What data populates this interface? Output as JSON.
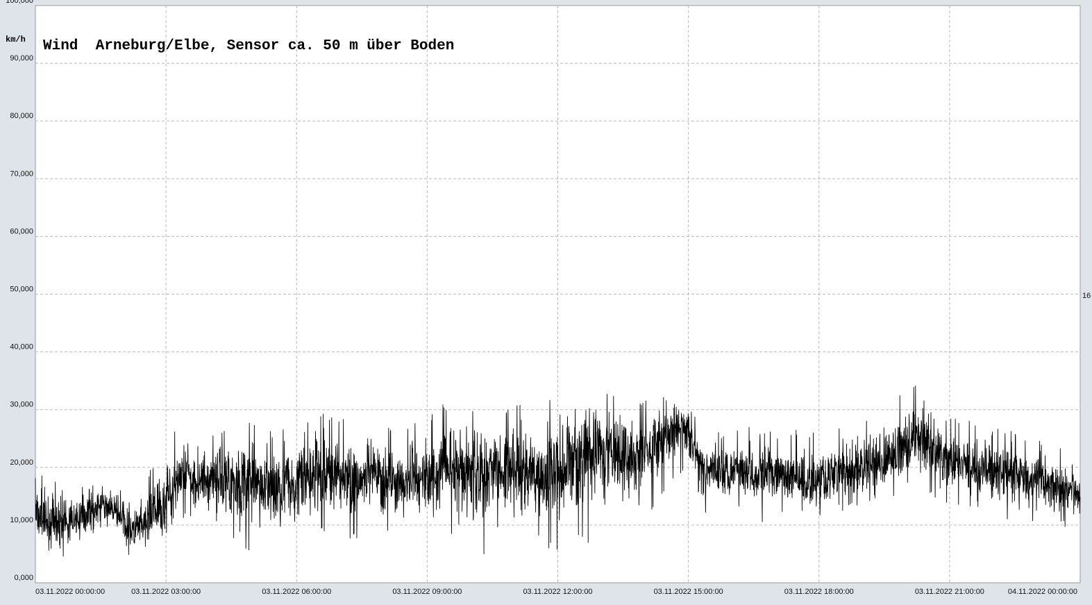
{
  "chart_data": {
    "type": "line",
    "title": "Wind  Arneburg/Elbe, Sensor ca. 50 m über Boden",
    "ylabel": "km/h",
    "xlabel": "",
    "ylim": [
      0,
      100000
    ],
    "xlim_hours": [
      0,
      24
    ],
    "grid": true,
    "line_color": "#000000",
    "grid_color": "#b8b8b8",
    "yticks": [
      "0,000",
      "10,000",
      "20,000",
      "30,000",
      "40,000",
      "50,000",
      "60,000",
      "70,000",
      "80,000",
      "90,000",
      "100,000"
    ],
    "ytick_values": [
      0,
      10000,
      20000,
      30000,
      40000,
      50000,
      60000,
      70000,
      80000,
      90000,
      100000
    ],
    "xticks": [
      "03.11.2022  00:00:00",
      "03.11.2022  03:00:00",
      "03.11.2022  06:00:00",
      "03.11.2022  09:00:00",
      "03.11.2022  12:00:00",
      "03.11.2022  15:00:00",
      "03.11.2022  18:00:00",
      "03.11.2022  21:00:00",
      "04.11.2022  00:00:00"
    ],
    "xtick_hours": [
      0,
      3,
      6,
      9,
      12,
      15,
      18,
      21,
      24
    ],
    "right_edge_label": "16",
    "series": [
      {
        "x_hours": [
          0,
          0.25,
          0.5,
          0.75,
          1,
          1.25,
          1.5,
          1.75,
          2,
          2.25,
          2.5,
          2.75,
          3,
          3.25,
          3.5,
          3.75,
          4,
          4.25,
          4.5,
          4.75,
          5,
          5.25,
          5.5,
          5.75,
          6,
          6.25,
          6.5,
          6.75,
          7,
          7.25,
          7.5,
          7.75,
          8,
          8.25,
          8.5,
          8.75,
          9,
          9.25,
          9.5,
          9.75,
          10,
          10.25,
          10.5,
          10.75,
          11,
          11.25,
          11.5,
          11.75,
          12,
          12.25,
          12.5,
          12.75,
          13,
          13.25,
          13.5,
          13.75,
          14,
          14.25,
          14.5,
          14.75,
          15,
          15.25,
          15.5,
          15.75,
          16,
          16.25,
          16.5,
          16.75,
          17,
          17.25,
          17.5,
          17.75,
          18,
          18.25,
          18.5,
          18.75,
          19,
          19.25,
          19.5,
          19.75,
          20,
          20.25,
          20.5,
          20.75,
          21,
          21.25,
          21.5,
          21.75,
          22,
          22.25,
          22.5,
          22.75,
          23,
          23.25,
          23.5,
          23.75,
          24
        ],
        "mean": [
          11000,
          10500,
          10000,
          10500,
          11000,
          12500,
          13500,
          13000,
          11000,
          9000,
          9500,
          11500,
          14000,
          17500,
          18500,
          17500,
          18000,
          18500,
          18000,
          17500,
          17000,
          16500,
          16000,
          17000,
          17500,
          18000,
          18500,
          19000,
          18500,
          18000,
          17500,
          18500,
          18000,
          17500,
          17500,
          18000,
          18500,
          19000,
          19500,
          20000,
          19500,
          19000,
          19500,
          19000,
          18500,
          19000,
          19000,
          19500,
          20000,
          21000,
          22000,
          22500,
          23000,
          22500,
          22000,
          21500,
          22000,
          23500,
          26000,
          27000,
          26500,
          20500,
          19500,
          19500,
          20000,
          20000,
          19500,
          19000,
          18500,
          18000,
          17500,
          17000,
          18000,
          18500,
          19000,
          19500,
          20000,
          20500,
          21000,
          22000,
          24000,
          25000,
          24500,
          22000,
          21000,
          20500,
          20000,
          20000,
          19500,
          19000,
          18500,
          18000,
          17500,
          17000,
          16500,
          16000,
          15500
        ],
        "max": [
          19500,
          18500,
          17500,
          17000,
          17000,
          17000,
          17500,
          17500,
          16000,
          15000,
          17500,
          21500,
          25000,
          27500,
          25500,
          25000,
          26500,
          27000,
          28500,
          28500,
          28000,
          27000,
          26500,
          28000,
          28500,
          29000,
          30500,
          29000,
          28500,
          28000,
          28000,
          28500,
          27500,
          26500,
          26500,
          28500,
          29000,
          30500,
          31500,
          31000,
          30500,
          34000,
          31000,
          30500,
          31000,
          32000,
          31500,
          31500,
          33000,
          35500,
          34000,
          35000,
          34500,
          33500,
          33000,
          31000,
          31500,
          32500,
          33000,
          33000,
          32000,
          27000,
          26500,
          26000,
          27000,
          27500,
          27000,
          26500,
          26500,
          26000,
          26500,
          26000,
          26500,
          27000,
          28000,
          28500,
          29000,
          29000,
          29500,
          31500,
          35500,
          35000,
          34000,
          30000,
          29000,
          28500,
          28000,
          27500,
          27000,
          26500,
          26500,
          26000,
          25500,
          24500,
          23500,
          22500,
          21000
        ],
        "min": [
          5000,
          4000,
          3500,
          5000,
          6000,
          7500,
          9000,
          9000,
          7000,
          3000,
          5000,
          6000,
          8000,
          10000,
          11000,
          10000,
          10500,
          9500,
          8000,
          5000,
          6000,
          7000,
          7000,
          4500,
          6500,
          7000,
          8000,
          9000,
          8500,
          7500,
          7500,
          8500,
          5000,
          7500,
          8000,
          8500,
          9000,
          8000,
          8000,
          9500,
          4000,
          3000,
          8000,
          8500,
          8000,
          8500,
          7500,
          6000,
          5500,
          6500,
          7000,
          6000,
          7500,
          9000,
          11000,
          11000,
          11500,
          12000,
          16000,
          19000,
          19000,
          11000,
          12000,
          12500,
          13000,
          12500,
          12000,
          10000,
          11000,
          11500,
          12000,
          11000,
          11000,
          11500,
          12000,
          12500,
          13500,
          14000,
          14500,
          15000,
          16000,
          16500,
          15500,
          13500,
          13000,
          12500,
          12000,
          12000,
          11500,
          11000,
          10500,
          10000,
          10500,
          10000,
          9500,
          9500,
          9500
        ]
      }
    ]
  }
}
